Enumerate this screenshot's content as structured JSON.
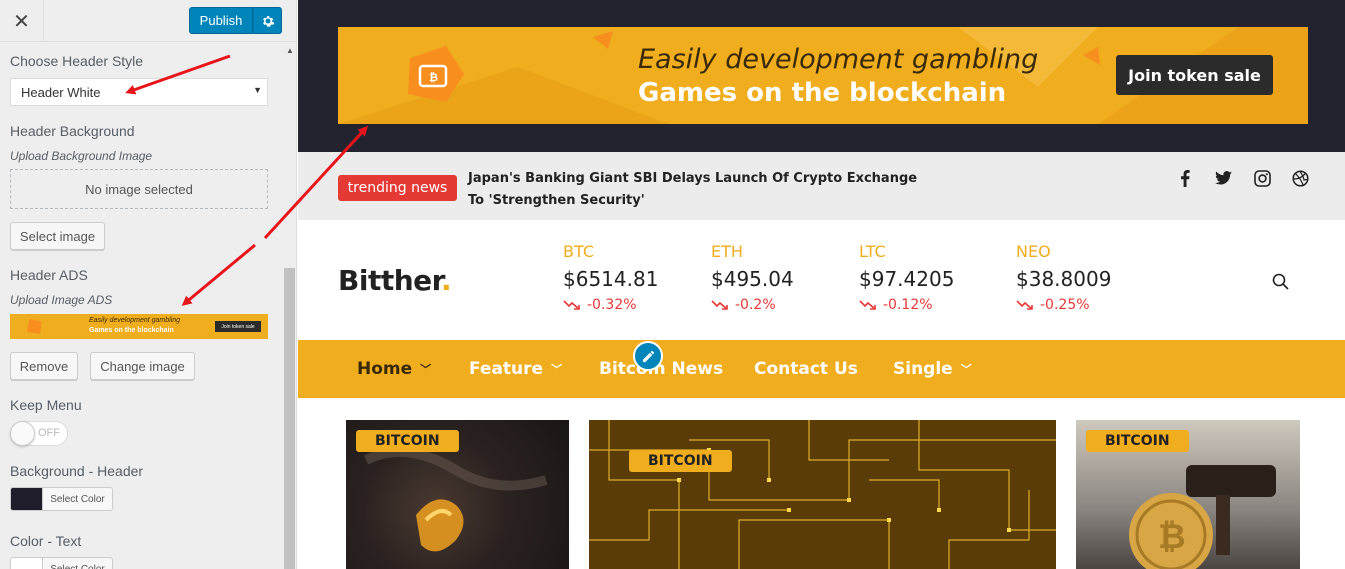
{
  "panel": {
    "close_label": "✕",
    "publish_label": "Publish",
    "sections": {
      "header_style": {
        "title": "Choose Header Style",
        "selected": "Header White"
      },
      "header_background": {
        "title": "Header Background",
        "desc": "Upload Background Image",
        "placeholder": "No image selected",
        "select_button": "Select image"
      },
      "header_ads": {
        "title": "Header ADS",
        "desc": "Upload Image ADS",
        "thumb_line1": "Easily development gambling",
        "thumb_line2": "Games on the blockchain",
        "thumb_cta": "Join token sale",
        "remove_button": "Remove",
        "change_button": "Change image"
      },
      "keep_menu": {
        "title": "Keep Menu",
        "toggle_label": "OFF"
      },
      "background_header": {
        "title": "Background - Header",
        "color_button": "Select Color",
        "swatch_color": "#1f1d2b"
      },
      "color_text": {
        "title": "Color - Text",
        "color_button": "Select Color"
      }
    }
  },
  "preview": {
    "ad": {
      "line1": "Easily development gambling",
      "line2": "Games on the blockchain",
      "cta": "Join token sale"
    },
    "trending": {
      "badge": "trending news",
      "headline": "Japan's Banking Giant SBI Delays Launch Of Crypto Exchange To 'Strengthen Security'"
    },
    "social": [
      "facebook-icon",
      "twitter-icon",
      "instagram-icon",
      "dribbble-icon"
    ],
    "logo": {
      "text": "Bitther",
      "dot": "."
    },
    "tickers": [
      {
        "symbol": "BTC",
        "price": "$6514.81",
        "change": "-0.32%"
      },
      {
        "symbol": "ETH",
        "price": "$495.04",
        "change": "-0.2%"
      },
      {
        "symbol": "LTC",
        "price": "$97.4205",
        "change": "-0.12%"
      },
      {
        "symbol": "NEO",
        "price": "$38.8009",
        "change": "-0.25%"
      }
    ],
    "nav": [
      {
        "label": "Home",
        "dropdown": true
      },
      {
        "label": "Feature",
        "dropdown": true
      },
      {
        "label": "Bitcoin News",
        "dropdown": false
      },
      {
        "label": "Contact Us",
        "dropdown": false
      },
      {
        "label": "Single",
        "dropdown": true
      }
    ],
    "cards": [
      {
        "tag": "BITCOIN"
      },
      {
        "tag": "BITCOIN"
      },
      {
        "tag": "BITCOIN"
      }
    ]
  },
  "colors": {
    "accent": "#f0ad1e",
    "dark": "#23222f",
    "wp_blue": "#0085ba",
    "down_red": "#e53935",
    "arrow_red": "#e8141b"
  }
}
